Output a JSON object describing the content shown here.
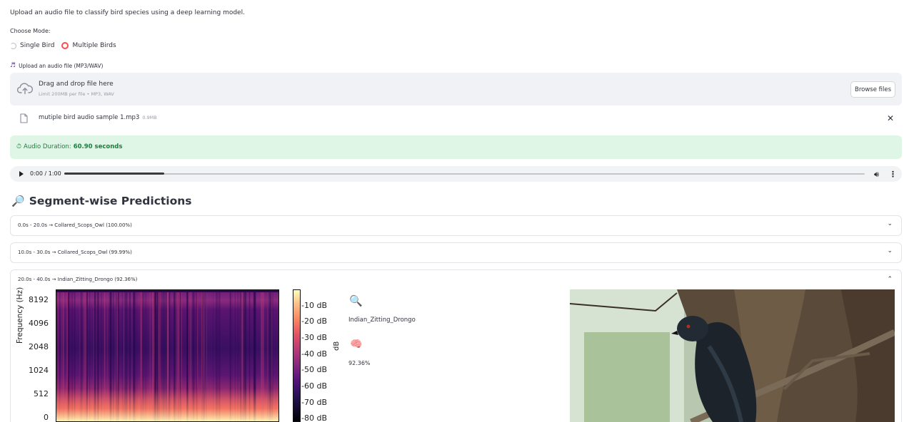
{
  "intro": "Upload an audio file to classify bird species using a deep learning model.",
  "mode": {
    "label": "Choose Mode:",
    "options": [
      "Single Bird",
      "Multiple Birds"
    ],
    "selected": "Multiple Birds"
  },
  "upload": {
    "label": "Upload an audio file (MP3/WAV)",
    "drop_title": "Drag and drop file here",
    "drop_sub": "Limit 200MB per file • MP3, WAV",
    "browse_label": "Browse files",
    "file_name": "mutiple bird audio sample 1.mp3",
    "file_size": "0.9MB"
  },
  "duration": {
    "prefix": "Audio Duration:",
    "value": "60.90 seconds"
  },
  "player": {
    "time": "0:00 / 1:00",
    "progress": 0.125
  },
  "section_title": "Segment-wise Predictions",
  "segments": [
    {
      "label": "0.0s - 20.0s → Collared_Scops_Owl (100.00%)",
      "expanded": false
    },
    {
      "label": "10.0s - 30.0s → Collared_Scops_Owl (99.99%)",
      "expanded": false
    },
    {
      "label": "20.0s - 40.0s → Indian_Zitting_Drongo (92.36%)",
      "expanded": true
    }
  ],
  "spectrogram": {
    "ylabel": "Frequency (Hz)",
    "yticks": [
      "8192",
      "4096",
      "2048",
      "1024",
      "512",
      "0"
    ],
    "colorbar_ticks": [
      "-10 dB",
      "-20 dB",
      "-30 dB",
      "-40 dB",
      "-50 dB",
      "-60 dB",
      "-70 dB",
      "-80 dB"
    ],
    "colorbar_label": "dB"
  },
  "prediction": {
    "species": "Indian_Zitting_Drongo",
    "confidence": "92.36%",
    "icons": [
      "magnifier-icon",
      "brain-icon"
    ]
  },
  "colors": {
    "accent": "#ff4b4b",
    "success_bg": "#dff5e6",
    "success_text": "#1a7f3c",
    "dropzone_bg": "#f0f2f6"
  }
}
